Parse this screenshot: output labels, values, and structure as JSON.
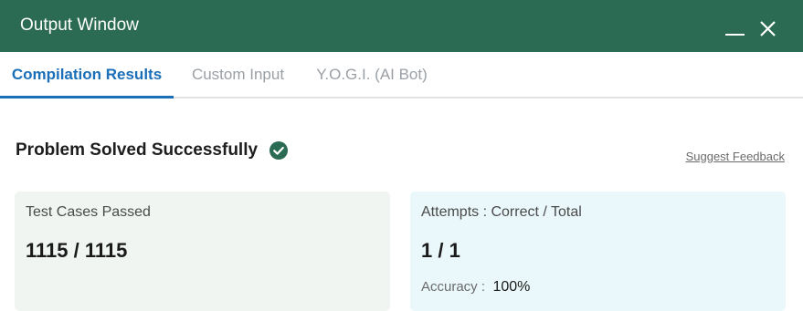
{
  "window": {
    "title": "Output Window"
  },
  "tabs": [
    {
      "label": "Compilation Results",
      "active": true
    },
    {
      "label": "Custom Input",
      "active": false
    },
    {
      "label": "Y.O.G.I. (AI Bot)",
      "active": false
    }
  ],
  "result": {
    "heading": "Problem Solved Successfully",
    "status_icon": "check-circle-icon",
    "feedback_link": "Suggest Feedback"
  },
  "test_cases": {
    "label": "Test Cases Passed",
    "value": "1115 / 1115"
  },
  "attempts": {
    "label": "Attempts : Correct / Total",
    "value": "1 / 1",
    "accuracy_label": "Accuracy :",
    "accuracy_value": "100%"
  },
  "colors": {
    "titlebar": "#2b6a53",
    "active_tab": "#1a6fb8",
    "success": "#2b6a53",
    "card_left_bg": "#f0f5f2",
    "card_right_bg": "#ebf8fb"
  }
}
